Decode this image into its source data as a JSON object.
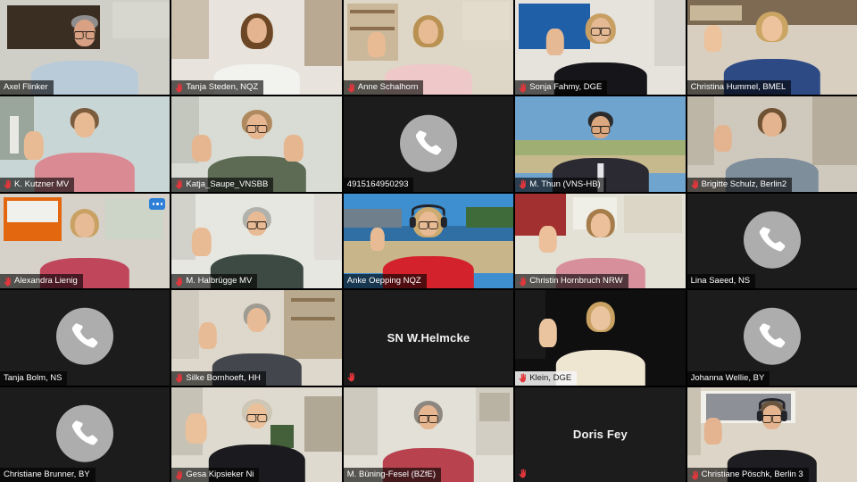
{
  "meeting": {
    "layout": "gallery",
    "columns": 5,
    "rows": 5,
    "accent_speaking": "#c8e64b",
    "accent_badge": "#2d7fd8",
    "hand_icon_color": "#e0363c"
  },
  "icons": {
    "phone": "phone-icon",
    "hand_raise": "hand-raise-icon",
    "more_options": "more-options-icon"
  },
  "participants": [
    {
      "id": "p1",
      "name": "Axel Flinker",
      "video": true,
      "hand": false,
      "label_style": "dark",
      "speaking": false
    },
    {
      "id": "p2",
      "name": "Tanja Steden, NQZ",
      "video": true,
      "hand": true,
      "label_style": "dark",
      "speaking": false
    },
    {
      "id": "p3",
      "name": "Anne Schalhorn",
      "video": true,
      "hand": true,
      "label_style": "dark",
      "speaking": false
    },
    {
      "id": "p4",
      "name": "Sonja Fahmy, DGE",
      "video": true,
      "hand": true,
      "label_style": "dark",
      "speaking": false
    },
    {
      "id": "p5",
      "name": "Christina Hummel, BMEL",
      "video": true,
      "hand": false,
      "label_style": "dark",
      "speaking": false
    },
    {
      "id": "p6",
      "name": "K. Kutzner MV",
      "video": true,
      "hand": true,
      "label_style": "dark",
      "speaking": false
    },
    {
      "id": "p7",
      "name": "Katja_Saupe_VNSBB",
      "video": true,
      "hand": true,
      "label_style": "dark",
      "speaking": false
    },
    {
      "id": "p8",
      "name": "4915164950293",
      "video": false,
      "hand": false,
      "label_style": "dark",
      "speaking": false
    },
    {
      "id": "p9",
      "name": "M. Thun (VNS-HB)",
      "video": true,
      "hand": true,
      "label_style": "dark",
      "speaking": false
    },
    {
      "id": "p10",
      "name": "Brigitte Schulz, Berlin2",
      "video": true,
      "hand": true,
      "label_style": "dark",
      "speaking": false
    },
    {
      "id": "p11",
      "name": "Alexandra Lienig",
      "video": true,
      "hand": true,
      "label_style": "dark",
      "speaking": false,
      "more_options": true
    },
    {
      "id": "p12",
      "name": "M. Halbrügge MV",
      "video": true,
      "hand": true,
      "label_style": "dark",
      "speaking": false
    },
    {
      "id": "p13",
      "name": "Anke Oepping NQZ",
      "video": true,
      "hand": false,
      "label_style": "dark",
      "speaking": true
    },
    {
      "id": "p14",
      "name": "Christin Hornbruch NRW",
      "video": true,
      "hand": true,
      "label_style": "dark",
      "speaking": false
    },
    {
      "id": "p15",
      "name": "Lina Saeed, NS",
      "video": false,
      "hand": false,
      "label_style": "dark",
      "speaking": false
    },
    {
      "id": "p16",
      "name": "Tanja Bolm, NS",
      "video": false,
      "hand": false,
      "label_style": "dark",
      "speaking": false
    },
    {
      "id": "p17",
      "name": "Silke Bornhoeft, HH",
      "video": true,
      "hand": true,
      "label_style": "dark",
      "speaking": false
    },
    {
      "id": "p18",
      "name": "SN W.Helmcke",
      "video": false,
      "hand": true,
      "label_style": "center",
      "speaking": false
    },
    {
      "id": "p19",
      "name": "Klein, DGE",
      "video": true,
      "hand": true,
      "label_style": "light",
      "speaking": false
    },
    {
      "id": "p20",
      "name": "Johanna Wellie, BY",
      "video": false,
      "hand": false,
      "label_style": "dark",
      "speaking": false
    },
    {
      "id": "p21",
      "name": "Christiane Brunner, BY",
      "video": false,
      "hand": false,
      "label_style": "dark",
      "speaking": false
    },
    {
      "id": "p22",
      "name": "Gesa Kipsieker Ni",
      "video": true,
      "hand": true,
      "label_style": "dark",
      "speaking": false
    },
    {
      "id": "p23",
      "name": "M. Büning-Fesel (BZfE)",
      "video": true,
      "hand": false,
      "label_style": "dark",
      "speaking": false
    },
    {
      "id": "p24",
      "name": "Doris Fey",
      "video": false,
      "hand": true,
      "label_style": "center",
      "speaking": false
    },
    {
      "id": "p25",
      "name": "Christiane Pöschk, Berlin 3",
      "video": true,
      "hand": true,
      "label_style": "dark",
      "speaking": false
    }
  ]
}
